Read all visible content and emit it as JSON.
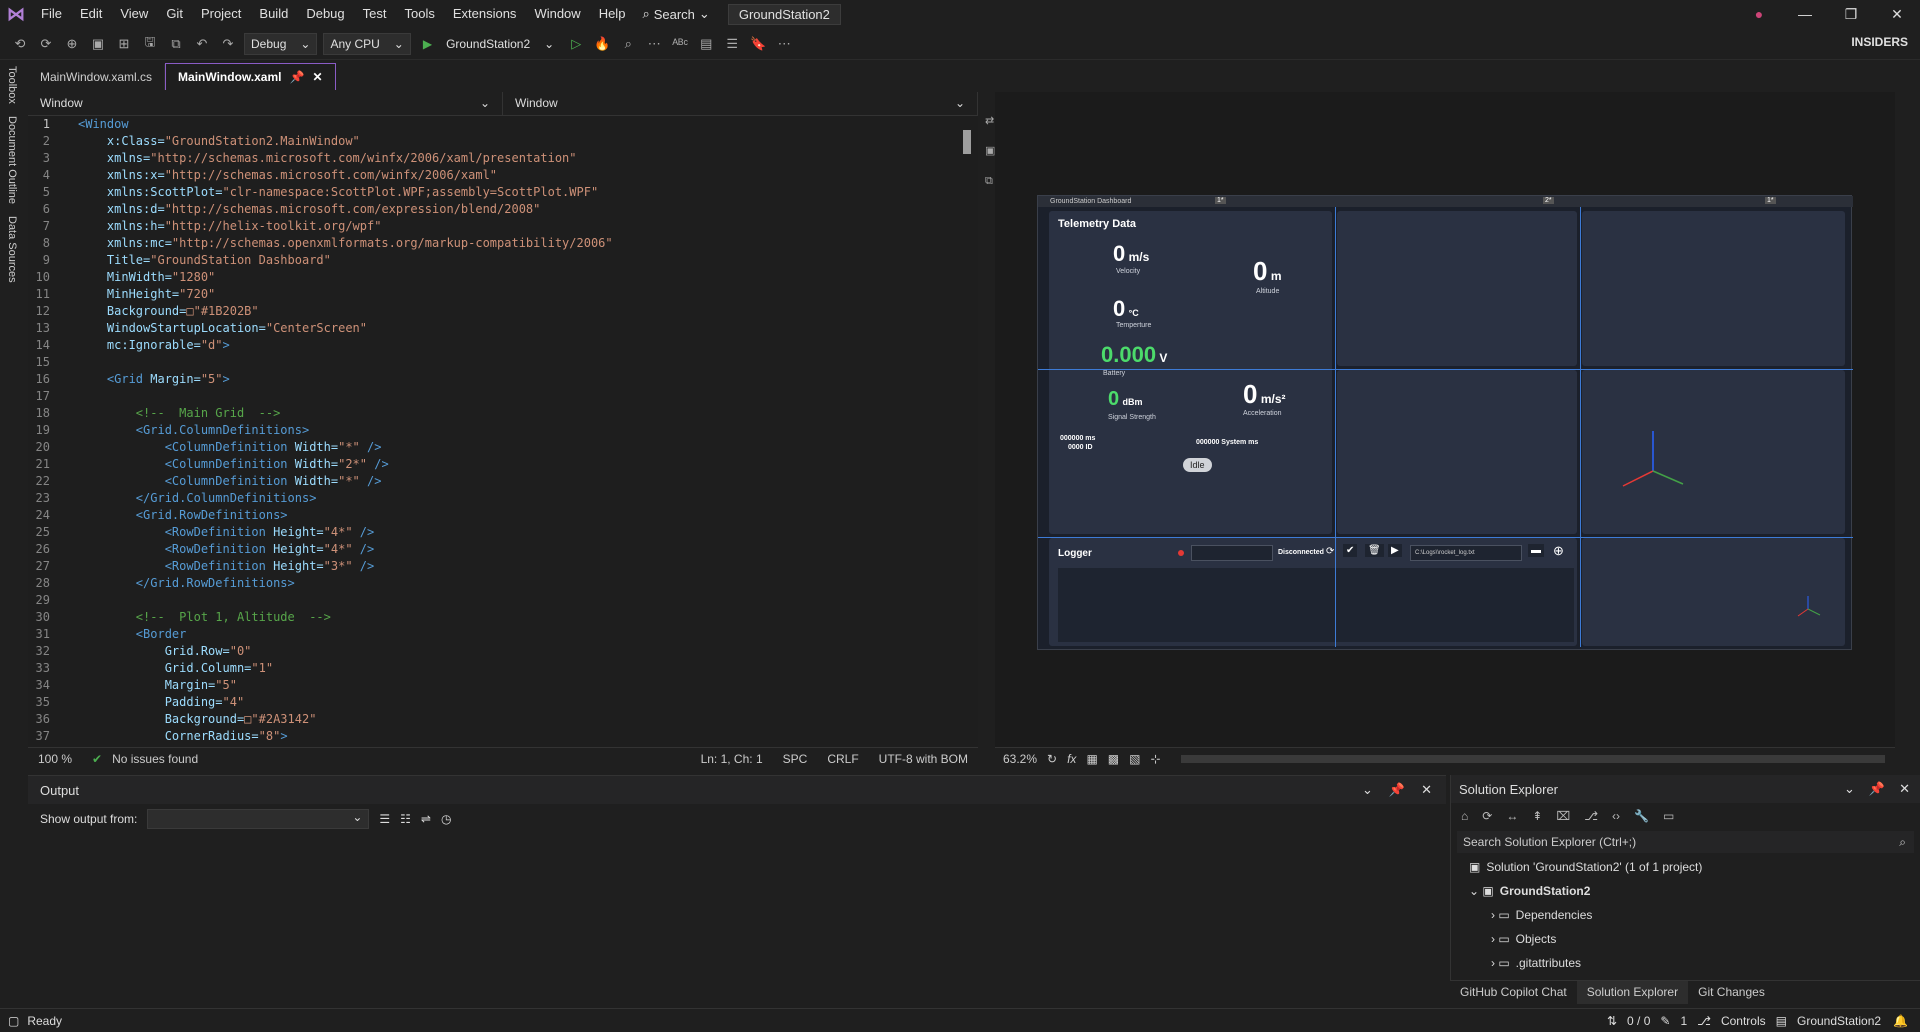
{
  "menu": [
    "File",
    "Edit",
    "View",
    "Git",
    "Project",
    "Build",
    "Debug",
    "Test",
    "Tools",
    "Extensions",
    "Window",
    "Help"
  ],
  "search_label": "Search",
  "solution_name": "GroundStation2",
  "toolbar": {
    "config": "Debug",
    "platform": "Any CPU",
    "start": "GroundStation2",
    "insiders": "INSIDERS"
  },
  "side_tabs": [
    "Toolbox",
    "Document Outline",
    "Data Sources"
  ],
  "tabs": [
    "MainWindow.xaml.cs",
    "MainWindow.xaml"
  ],
  "nav": [
    "Window",
    "Window"
  ],
  "code": [
    [
      [
        "c-tag",
        "<Window"
      ]
    ],
    [
      [
        "c-att",
        "    x:Class="
      ],
      [
        "c-str",
        "\"GroundStation2.MainWindow\""
      ]
    ],
    [
      [
        "c-att",
        "    xmlns="
      ],
      [
        "c-str",
        "\"http://schemas.microsoft.com/winfx/2006/xaml/presentation\""
      ]
    ],
    [
      [
        "c-att",
        "    xmlns:x="
      ],
      [
        "c-str",
        "\"http://schemas.microsoft.com/winfx/2006/xaml\""
      ]
    ],
    [
      [
        "c-att",
        "    xmlns:ScottPlot="
      ],
      [
        "c-str",
        "\"clr-namespace:ScottPlot.WPF;assembly=ScottPlot.WPF\""
      ]
    ],
    [
      [
        "c-att",
        "    xmlns:d="
      ],
      [
        "c-str",
        "\"http://schemas.microsoft.com/expression/blend/2008\""
      ]
    ],
    [
      [
        "c-att",
        "    xmlns:h="
      ],
      [
        "c-str",
        "\"http://helix-toolkit.org/wpf\""
      ]
    ],
    [
      [
        "c-att",
        "    xmlns:mc="
      ],
      [
        "c-str",
        "\"http://schemas.openxmlformats.org/markup-compatibility/2006\""
      ]
    ],
    [
      [
        "c-att",
        "    Title="
      ],
      [
        "c-str",
        "\"GroundStation Dashboard\""
      ]
    ],
    [
      [
        "c-att",
        "    MinWidth="
      ],
      [
        "c-str",
        "\"1280\""
      ]
    ],
    [
      [
        "c-att",
        "    MinHeight="
      ],
      [
        "c-str",
        "\"720\""
      ]
    ],
    [
      [
        "c-att",
        "    Background="
      ],
      [
        "c-str",
        "□\"#1B202B\""
      ]
    ],
    [
      [
        "c-att",
        "    WindowStartupLocation="
      ],
      [
        "c-str",
        "\"CenterScreen\""
      ]
    ],
    [
      [
        "c-att",
        "    mc:Ignorable="
      ],
      [
        "c-str",
        "\"d\""
      ],
      [
        "c-tag",
        ">"
      ]
    ],
    [],
    [
      [
        "c-tag",
        "    <Grid "
      ],
      [
        "c-att",
        "Margin="
      ],
      [
        "c-str",
        "\"5\""
      ],
      [
        "c-tag",
        ">"
      ]
    ],
    [],
    [
      [
        "c-cmt",
        "        <!--  Main Grid  -->"
      ]
    ],
    [
      [
        "c-tag",
        "        <Grid.ColumnDefinitions>"
      ]
    ],
    [
      [
        "c-tag",
        "            <ColumnDefinition "
      ],
      [
        "c-att",
        "Width="
      ],
      [
        "c-str",
        "\"*\""
      ],
      [
        "c-tag",
        " />"
      ]
    ],
    [
      [
        "c-tag",
        "            <ColumnDefinition "
      ],
      [
        "c-att",
        "Width="
      ],
      [
        "c-str",
        "\"2*\""
      ],
      [
        "c-tag",
        " />"
      ]
    ],
    [
      [
        "c-tag",
        "            <ColumnDefinition "
      ],
      [
        "c-att",
        "Width="
      ],
      [
        "c-str",
        "\"*\""
      ],
      [
        "c-tag",
        " />"
      ]
    ],
    [
      [
        "c-tag",
        "        </Grid.ColumnDefinitions>"
      ]
    ],
    [
      [
        "c-tag",
        "        <Grid.RowDefinitions>"
      ]
    ],
    [
      [
        "c-tag",
        "            <RowDefinition "
      ],
      [
        "c-att",
        "Height="
      ],
      [
        "c-str",
        "\"4*\""
      ],
      [
        "c-tag",
        " />"
      ]
    ],
    [
      [
        "c-tag",
        "            <RowDefinition "
      ],
      [
        "c-att",
        "Height="
      ],
      [
        "c-str",
        "\"4*\""
      ],
      [
        "c-tag",
        " />"
      ]
    ],
    [
      [
        "c-tag",
        "            <RowDefinition "
      ],
      [
        "c-att",
        "Height="
      ],
      [
        "c-str",
        "\"3*\""
      ],
      [
        "c-tag",
        " />"
      ]
    ],
    [
      [
        "c-tag",
        "        </Grid.RowDefinitions>"
      ]
    ],
    [],
    [
      [
        "c-cmt",
        "        <!--  Plot 1, Altitude  -->"
      ]
    ],
    [
      [
        "c-tag",
        "        <Border"
      ]
    ],
    [
      [
        "c-att",
        "            Grid.Row="
      ],
      [
        "c-str",
        "\"0\""
      ]
    ],
    [
      [
        "c-att",
        "            Grid.Column="
      ],
      [
        "c-str",
        "\"1\""
      ]
    ],
    [
      [
        "c-att",
        "            Margin="
      ],
      [
        "c-str",
        "\"5\""
      ]
    ],
    [
      [
        "c-att",
        "            Padding="
      ],
      [
        "c-str",
        "\"4\""
      ]
    ],
    [
      [
        "c-att",
        "            Background="
      ],
      [
        "c-str",
        "□\"#2A3142\""
      ]
    ],
    [
      [
        "c-att",
        "            CornerRadius="
      ],
      [
        "c-str",
        "\"8\""
      ],
      [
        "c-tag",
        ">"
      ]
    ]
  ],
  "status1": {
    "zoom": "100 %",
    "issues": "No issues found",
    "pos": "Ln: 1, Ch: 1",
    "spc": "SPC",
    "crlf": "CRLF",
    "enc": "UTF-8 with BOM"
  },
  "design": {
    "title": "GroundStation Dashboard",
    "col_marks": [
      "1*",
      "2*",
      "1*"
    ],
    "telemetry": "Telemetry Data",
    "velocity": {
      "v": "0",
      "u": "m/s",
      "l": "Velocity"
    },
    "altitude": {
      "v": "0",
      "u": "m",
      "l": "Altitude"
    },
    "temperature": {
      "v": "0",
      "u": "°C",
      "l": "Temperture"
    },
    "battery": {
      "v": "0.000",
      "u": "V",
      "l": "Battery"
    },
    "signal": {
      "v": "0",
      "u": "dBm",
      "l": "Signal Strength"
    },
    "accel": {
      "v": "0",
      "u": "m/s²",
      "l": "Acceleration"
    },
    "ms": "000000 ms",
    "id": "0000  ID",
    "sysms": "000000 System ms",
    "idle": "Idle",
    "logger": "Logger",
    "disconnected": "Disconnected",
    "logpath": "C:\\Logs\\\\rocket_log.txt",
    "zoom": "63.2%"
  },
  "output": {
    "title": "Output",
    "show_from": "Show output from:"
  },
  "solution": {
    "title": "Solution Explorer",
    "search": "Search Solution Explorer (Ctrl+;)",
    "items": [
      {
        "t": "Solution 'GroundStation2' (1 of 1 project)",
        "b": false
      },
      {
        "t": "GroundStation2",
        "b": true
      },
      {
        "t": "Dependencies",
        "b": false
      },
      {
        "t": "Objects",
        "b": false
      },
      {
        "t": ".gitattributes",
        "b": false
      }
    ]
  },
  "bottom_tabs": [
    "GitHub Copilot Chat",
    "Solution Explorer",
    "Git Changes"
  ],
  "status": {
    "ready": "Ready",
    "sync": "0 / 0",
    "edits": "1",
    "controls": "Controls",
    "project": "GroundStation2"
  },
  "colors": {
    "accent": "#8a5cc6",
    "line": "#3d7bd6",
    "battery": "#4cdb6b"
  }
}
